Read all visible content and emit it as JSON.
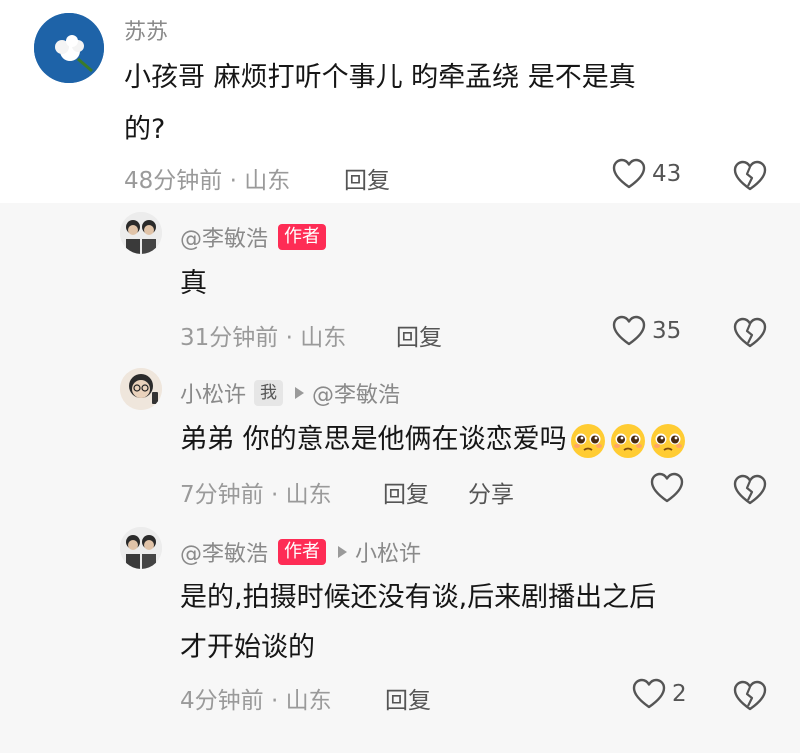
{
  "comments": [
    {
      "user": "苏苏",
      "text_line1": "小孩哥  麻烦打听个事儿    昀牵孟绕   是不是真",
      "text_line2": "的?",
      "time_location": "48分钟前 · 山东",
      "reply_label": "回复",
      "like_count": "43"
    }
  ],
  "replies": [
    {
      "user": "@李敏浩",
      "author_tag": "作者",
      "text": "真",
      "time_location": "31分钟前 · 山东",
      "reply_label": "回复",
      "like_count": "35"
    },
    {
      "user": "小松许",
      "me_tag": "我",
      "reply_to": "@李敏浩",
      "text": "弟弟 你的意思是他俩在谈恋爱吗",
      "time_location": "7分钟前 · 山东",
      "reply_label": "回复",
      "share_label": "分享"
    },
    {
      "user": "@李敏浩",
      "author_tag": "作者",
      "reply_to": "小松许",
      "text_line1": "是的,拍摄时候还没有谈,后来剧播出之后",
      "text_line2": "才开始谈的",
      "time_location": "4分钟前 · 山东",
      "reply_label": "回复",
      "like_count": "2"
    }
  ],
  "icons": {
    "like": "heart-outline-icon",
    "dislike": "broken-heart-icon",
    "emoji": "pleading-face-emoji"
  },
  "colors": {
    "author_tag": "#fe2c55",
    "meta_text": "#9a9a9a"
  }
}
